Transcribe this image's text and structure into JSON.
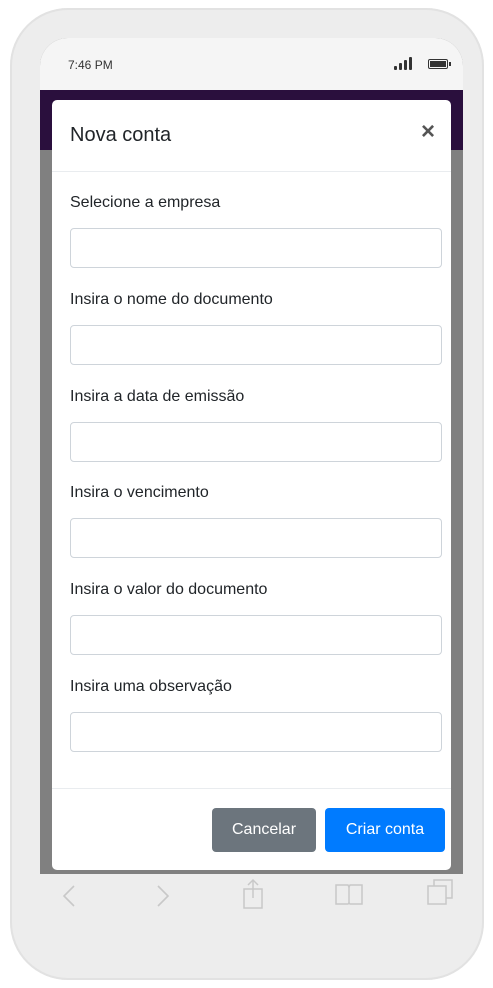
{
  "status_bar": {
    "time": "7:46 PM"
  },
  "modal": {
    "title": "Nova conta",
    "close_label": "×",
    "fields": [
      {
        "label": "Selecione a empresa",
        "value": "",
        "placeholder": ""
      },
      {
        "label": "Insira o nome do documento",
        "value": "",
        "placeholder": ""
      },
      {
        "label": "Insira a data de emissão",
        "value": "",
        "placeholder": ""
      },
      {
        "label": "Insira o vencimento",
        "value": "",
        "placeholder": ""
      },
      {
        "label": "Insira o valor do documento",
        "value": "",
        "placeholder": ""
      },
      {
        "label": "Insira uma observação",
        "value": "",
        "placeholder": ""
      }
    ],
    "footer": {
      "cancel_label": "Cancelar",
      "submit_label": "Criar conta"
    }
  },
  "browser_toolbar": {
    "icons": [
      "back-icon",
      "forward-icon",
      "share-icon",
      "bookmarks-icon",
      "tabs-icon"
    ]
  },
  "colors": {
    "app_bar": "#2a0f3d",
    "primary": "#007bff",
    "secondary": "#6c757d",
    "backdrop": "#808080"
  }
}
